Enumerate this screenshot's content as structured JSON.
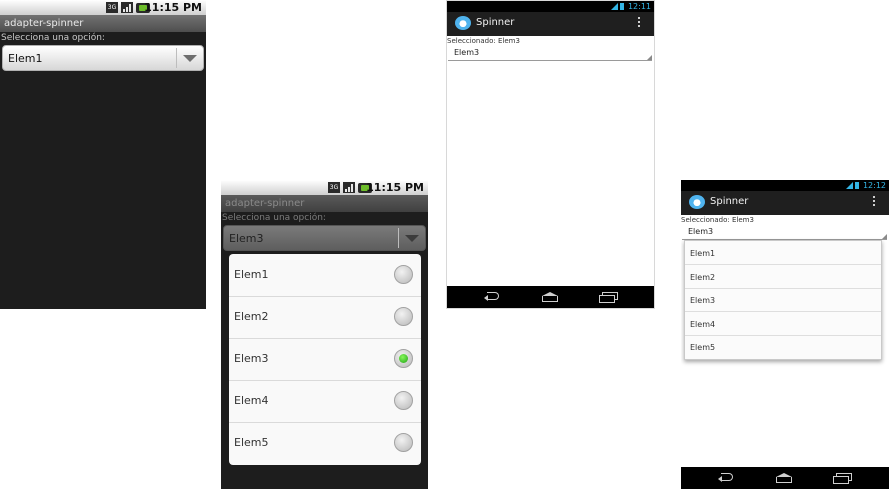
{
  "gingerbread": {
    "status_time": "11:15 PM",
    "network_label": "3G",
    "app_title": "adapter-spinner",
    "prompt_label": "Selecciona una opción:",
    "screen1_selected": "Elem1",
    "screen2_selected": "Elem3",
    "dialog_items": [
      "Elem1",
      "Elem2",
      "Elem3",
      "Elem4",
      "Elem5"
    ],
    "dialog_checked_index": 2
  },
  "holo": {
    "status_time": "12:11",
    "status_time_2": "12:12",
    "app_title": "Spinner",
    "selected_label": "Seleccionado: Elem3",
    "spinner_value": "Elem3",
    "dropdown_items": [
      "Elem1",
      "Elem2",
      "Elem3",
      "Elem4",
      "Elem5"
    ],
    "accent_color": "#33b5e5"
  }
}
